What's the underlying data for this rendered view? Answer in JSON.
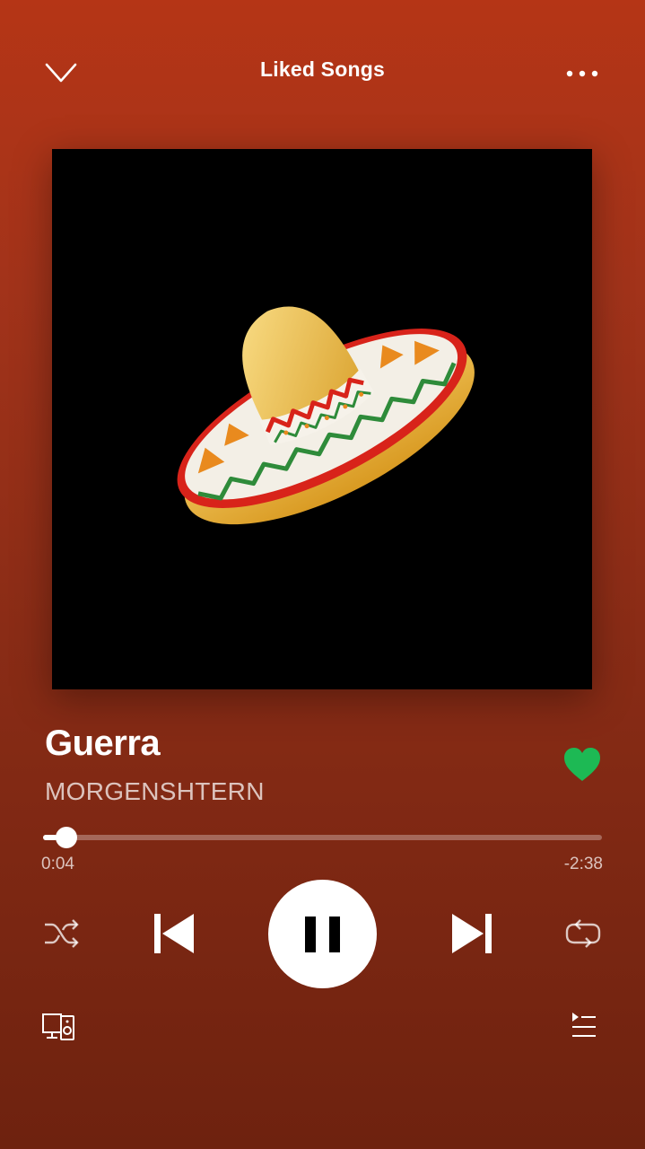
{
  "header": {
    "title": "Liked Songs",
    "icons": [
      "chevron-down-icon",
      "more-options-icon"
    ]
  },
  "track": {
    "title": "Guerra",
    "artist": "MORGENSHTERN",
    "liked": true,
    "cover_art": "sombrero-emoji"
  },
  "playback": {
    "elapsed": "0:04",
    "remaining": "-2:38",
    "progress_fraction": 0.025,
    "state": "playing"
  },
  "controls": {
    "icons": [
      "shuffle-icon",
      "previous-icon",
      "pause-icon",
      "next-icon",
      "repeat-icon",
      "devices-icon",
      "queue-icon"
    ]
  },
  "colors": {
    "background_top": "#b53516",
    "background_bottom": "#6e220f",
    "liked_green": "#1db954",
    "foreground": "#ffffff"
  }
}
